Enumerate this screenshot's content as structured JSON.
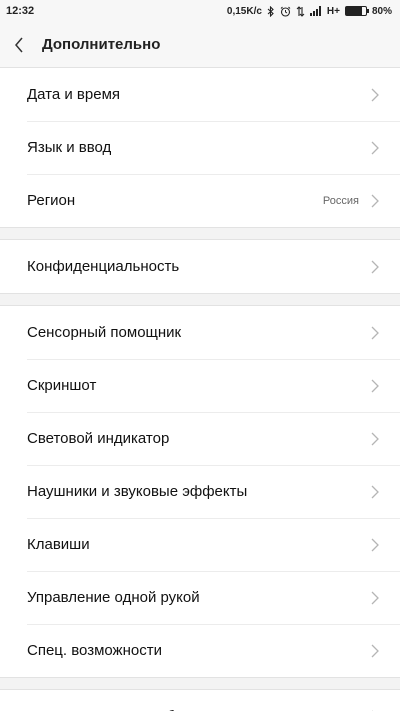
{
  "status_bar": {
    "time": "12:32",
    "speed": "0,15K/c",
    "network": "H+",
    "battery": "80%",
    "battery_level": 0.8
  },
  "header": {
    "title": "Дополнительно"
  },
  "groups": [
    {
      "items": [
        {
          "label": "Дата и время"
        },
        {
          "label": "Язык и ввод"
        },
        {
          "label": "Регион",
          "value": "Россия"
        }
      ]
    },
    {
      "items": [
        {
          "label": "Конфиденциальность"
        }
      ]
    },
    {
      "items": [
        {
          "label": "Сенсорный помощник"
        },
        {
          "label": "Скриншот"
        },
        {
          "label": "Световой индикатор"
        },
        {
          "label": "Наушники и звуковые эффекты"
        },
        {
          "label": "Клавиши"
        },
        {
          "label": "Управление одной рукой"
        },
        {
          "label": "Спец. возможности"
        }
      ]
    },
    {
      "items": [
        {
          "label": "Восстановление и сброс"
        }
      ]
    }
  ]
}
